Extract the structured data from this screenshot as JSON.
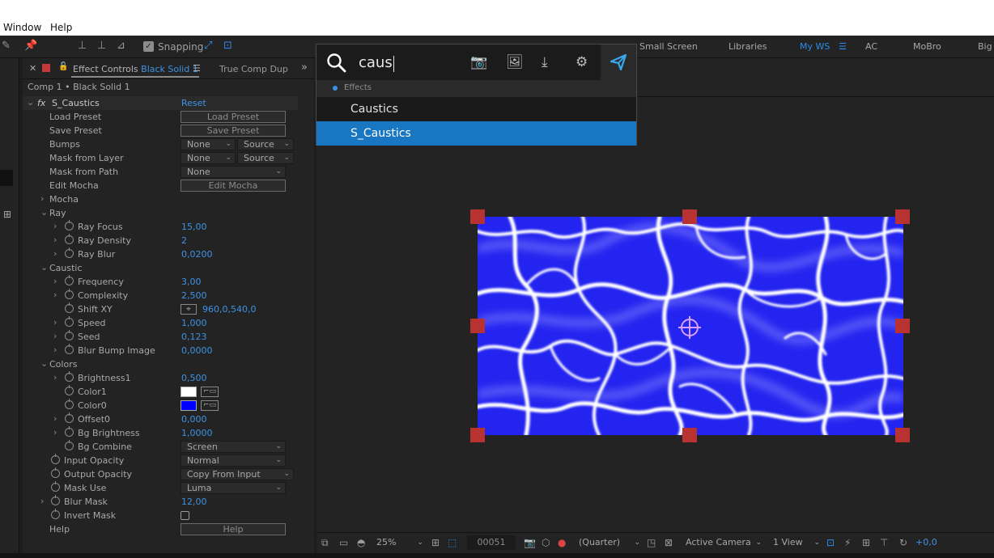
{
  "menubar": {
    "items": [
      "Window",
      "Help"
    ]
  },
  "toolbar": {
    "snapping_label": "Snapping",
    "workspaces": [
      "Small Screen",
      "Libraries",
      "My WS",
      "AC",
      "MoBro",
      "Big"
    ],
    "active_workspace": "My WS"
  },
  "effect_controls": {
    "tab_label": "Effect Controls",
    "tab_layer": "Black Solid 1",
    "tab_other": "True Comp Dup",
    "header": "Comp 1 • Black Solid 1",
    "effect_name": "S_Caustics",
    "reset_label": "Reset",
    "load_preset": {
      "label": "Load Preset",
      "button": "Load Preset"
    },
    "save_preset": {
      "label": "Save Preset",
      "button": "Save Preset"
    },
    "bumps": {
      "label": "Bumps",
      "value": "None",
      "source": "Source"
    },
    "mask_from_layer": {
      "label": "Mask from Layer",
      "value": "None",
      "source": "Source"
    },
    "mask_from_path": {
      "label": "Mask from Path",
      "value": "None"
    },
    "edit_mocha": {
      "label": "Edit Mocha",
      "button": "Edit Mocha"
    },
    "mocha": {
      "label": "Mocha"
    },
    "ray": {
      "label": "Ray",
      "focus": {
        "label": "Ray Focus",
        "value": "15,00"
      },
      "density": {
        "label": "Ray Density",
        "value": "2"
      },
      "blur": {
        "label": "Ray Blur",
        "value": "0,0200"
      }
    },
    "caustic": {
      "label": "Caustic",
      "frequency": {
        "label": "Frequency",
        "value": "3,00"
      },
      "complexity": {
        "label": "Complexity",
        "value": "2,500"
      },
      "shift_xy": {
        "label": "Shift XY",
        "value": "960,0,540,0"
      },
      "speed": {
        "label": "Speed",
        "value": "1,000"
      },
      "seed": {
        "label": "Seed",
        "value": "0,123"
      },
      "blur_bump": {
        "label": "Blur Bump Image",
        "value": "0,0000"
      }
    },
    "colors": {
      "label": "Colors",
      "brightness1": {
        "label": "Brightness1",
        "value": "0,500"
      },
      "color1": {
        "label": "Color1",
        "value": "#ffffff"
      },
      "color0": {
        "label": "Color0",
        "value": "#0000ff"
      },
      "offset0": {
        "label": "Offset0",
        "value": "0,000"
      },
      "bg_brightness": {
        "label": "Bg Brightness",
        "value": "1,0000"
      },
      "bg_combine": {
        "label": "Bg Combine",
        "value": "Screen"
      }
    },
    "input_opacity": {
      "label": "Input Opacity",
      "value": "Normal"
    },
    "output_opacity": {
      "label": "Output Opacity",
      "value": "Copy From Input"
    },
    "mask_use": {
      "label": "Mask Use",
      "value": "Luma"
    },
    "blur_mask": {
      "label": "Blur Mask",
      "value": "12,00"
    },
    "invert_mask": {
      "label": "Invert Mask"
    },
    "help": {
      "label": "Help",
      "button": "Help"
    }
  },
  "search": {
    "query": "caus",
    "section": "Effects",
    "results": [
      "Caustics",
      "S_Caustics"
    ],
    "selected": "S_Caustics"
  },
  "viewer": {
    "zoom": "25%",
    "frame": "00051",
    "resolution": "(Quarter)",
    "camera": "Active Camera",
    "views": "1 View",
    "exposure": "+0,0"
  },
  "colors": {
    "accent": "#2d8ceb",
    "highlight": "#1976c2",
    "handle": "#b83232",
    "solid_blue": "#2222f2"
  }
}
